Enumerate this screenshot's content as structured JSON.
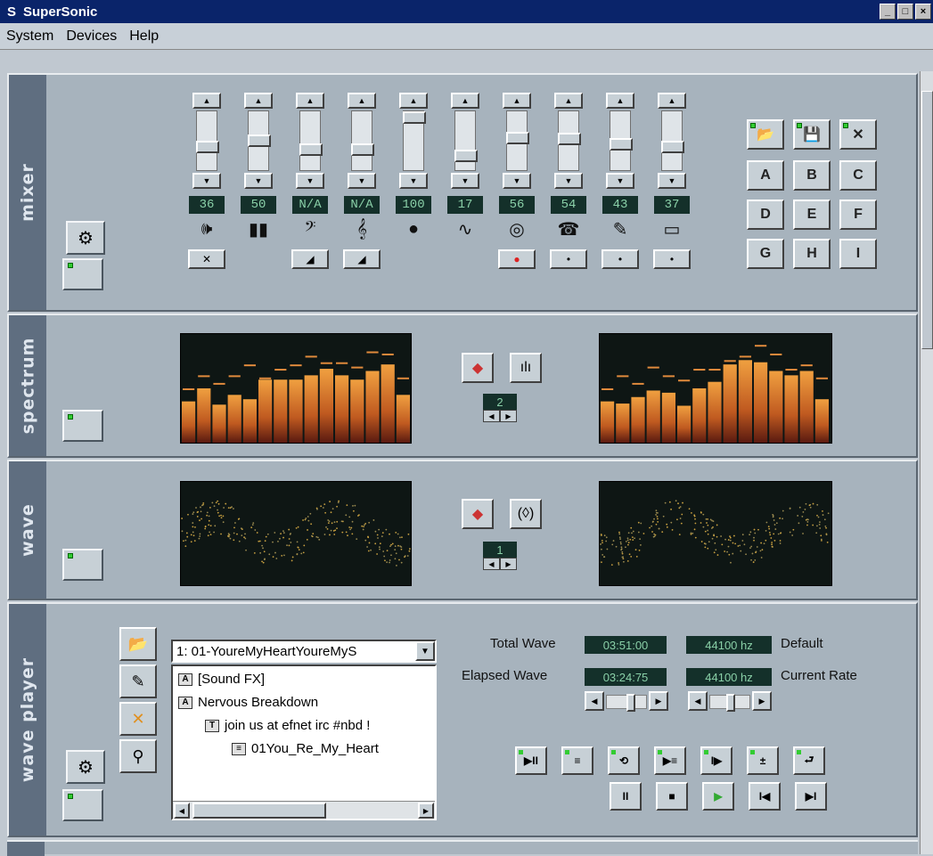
{
  "app": {
    "title": "SuperSonic",
    "logo": "S"
  },
  "window_controls": {
    "minimize": "_",
    "maximize": "□",
    "close": "×"
  },
  "menu": {
    "items": [
      "System",
      "Devices",
      "Help"
    ]
  },
  "mixer": {
    "label": "mixer",
    "channels": [
      {
        "value": "36",
        "level": 0.36,
        "icon": "speaker-icon",
        "glyph": "🕪",
        "button": "✕"
      },
      {
        "value": "50",
        "level": 0.5,
        "icon": "equalizer-icon",
        "glyph": "▮▮",
        "button": ""
      },
      {
        "value": "N/A",
        "level": 0.3,
        "icon": "bass-clef-icon",
        "glyph": "𝄢",
        "button": "◢"
      },
      {
        "value": "N/A",
        "level": 0.3,
        "icon": "treble-clef-icon",
        "glyph": "𝄞",
        "button": "◢"
      },
      {
        "value": "100",
        "level": 1.0,
        "icon": "dot-icon",
        "glyph": "●",
        "button": ""
      },
      {
        "value": "17",
        "level": 0.17,
        "icon": "waveform-icon",
        "glyph": "∿",
        "button": ""
      },
      {
        "value": "56",
        "level": 0.56,
        "icon": "cd-icon",
        "glyph": "◎",
        "button": "●"
      },
      {
        "value": "54",
        "level": 0.54,
        "icon": "phone-icon",
        "glyph": "☎",
        "button": "•"
      },
      {
        "value": "43",
        "level": 0.43,
        "icon": "pen-icon",
        "glyph": "✎",
        "button": "•"
      },
      {
        "value": "37",
        "level": 0.37,
        "icon": "ruler-icon",
        "glyph": "▭",
        "button": "•"
      }
    ],
    "preset_tools": [
      {
        "icon": "open-folder-icon",
        "glyph": "📂"
      },
      {
        "icon": "save-icon",
        "glyph": "💾"
      },
      {
        "icon": "close-icon",
        "glyph": "✕"
      }
    ],
    "presets": [
      "A",
      "B",
      "C",
      "D",
      "E",
      "F",
      "G",
      "H",
      "I"
    ]
  },
  "spectrum": {
    "label": "spectrum",
    "channel_number": "2",
    "left_bars": [
      0.38,
      0.5,
      0.35,
      0.44,
      0.4,
      0.58,
      0.58,
      0.58,
      0.62,
      0.68,
      0.62,
      0.58,
      0.66,
      0.72,
      0.44
    ],
    "left_peaks": [
      0.5,
      0.62,
      0.55,
      0.62,
      0.72,
      0.6,
      0.68,
      0.72,
      0.8,
      0.74,
      0.74,
      0.7,
      0.84,
      0.82,
      0.6
    ],
    "right_bars": [
      0.38,
      0.36,
      0.42,
      0.48,
      0.46,
      0.34,
      0.5,
      0.56,
      0.72,
      0.76,
      0.74,
      0.66,
      0.62,
      0.66,
      0.4
    ],
    "right_peaks": [
      0.5,
      0.62,
      0.55,
      0.7,
      0.62,
      0.58,
      0.68,
      0.68,
      0.76,
      0.8,
      0.9,
      0.82,
      0.68,
      0.72,
      0.6
    ]
  },
  "wave": {
    "label": "wave",
    "channel_number": "1"
  },
  "wave_player": {
    "label": "wave player",
    "track_select": "1: 01-YoureMyHeartYoureMyS",
    "tree": [
      {
        "tag": "A",
        "text": "[Sound FX]",
        "indent": 0
      },
      {
        "tag": "A",
        "text": "Nervous Breakdown",
        "indent": 0
      },
      {
        "tag": "T",
        "text": "join us at efnet irc #nbd !",
        "indent": 1
      },
      {
        "tag": "≡",
        "text": "01You_Re_My_Heart",
        "indent": 2
      }
    ],
    "total_wave_label": "Total Wave",
    "total_wave_time": "03:51:00",
    "elapsed_wave_label": "Elapsed Wave",
    "elapsed_wave_time": "03:24:75",
    "default_rate": "44100 hz",
    "default_label": "Default",
    "current_rate": "44100 hz",
    "current_rate_label": "Current Rate",
    "transport_top": [
      "▶II",
      "≡",
      "⟲",
      "▶≡",
      "I▶",
      "±",
      "⮐"
    ],
    "transport_bottom": [
      "II",
      "■",
      "▶",
      "I◀",
      "▶I"
    ]
  }
}
